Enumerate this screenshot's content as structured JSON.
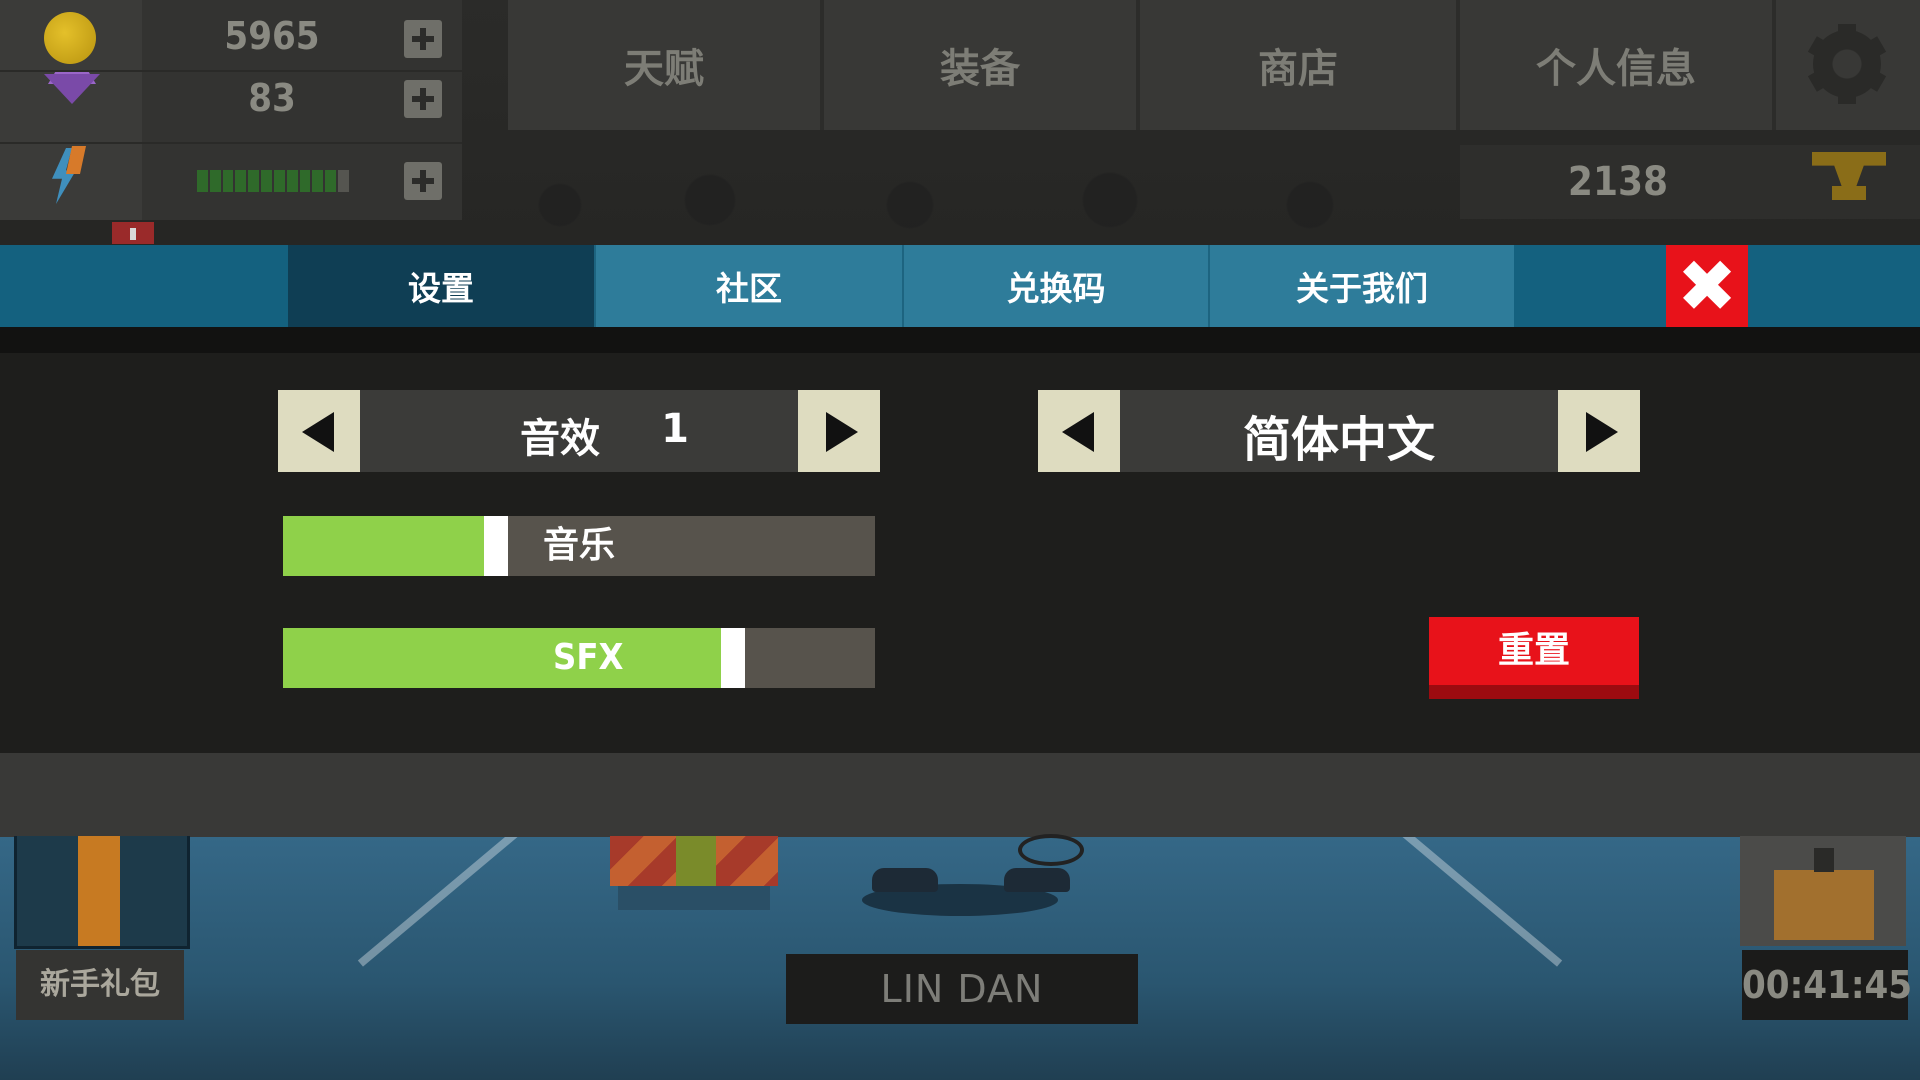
{
  "resources": {
    "coins": "5965",
    "gems": "83",
    "energy_level": 0.92,
    "energy_segments_total": 12,
    "energy_segments_filled": 11
  },
  "top_tabs": [
    "天赋",
    "装备",
    "商店",
    "个人信息"
  ],
  "trophies": "2138",
  "settings": {
    "tabs": [
      "设置",
      "社区",
      "兑换码",
      "关于我们"
    ],
    "active_tab": "设置",
    "sound_label": "音效",
    "sound_value": "1",
    "language": "简体中文",
    "music_label": "音乐",
    "music_level": 0.36,
    "sfx_label": "SFX",
    "sfx_level": 0.76,
    "reset_label": "重置"
  },
  "bottom": {
    "starter_pack": "新手礼包",
    "player_name": "LIN DAN",
    "timer": "00:41:45"
  },
  "colors": {
    "accent_blue": "#14617f",
    "tab_active": "#0f3e54",
    "close_red": "#e8121a",
    "slider_green": "#8fd14a"
  },
  "icons": [
    "coin-icon",
    "gem-icon",
    "energy-icon",
    "plus-icon",
    "gear-icon",
    "trophy-icon",
    "close-icon",
    "arrow-left-icon",
    "arrow-right-icon",
    "chest-icon",
    "gift-icon"
  ]
}
